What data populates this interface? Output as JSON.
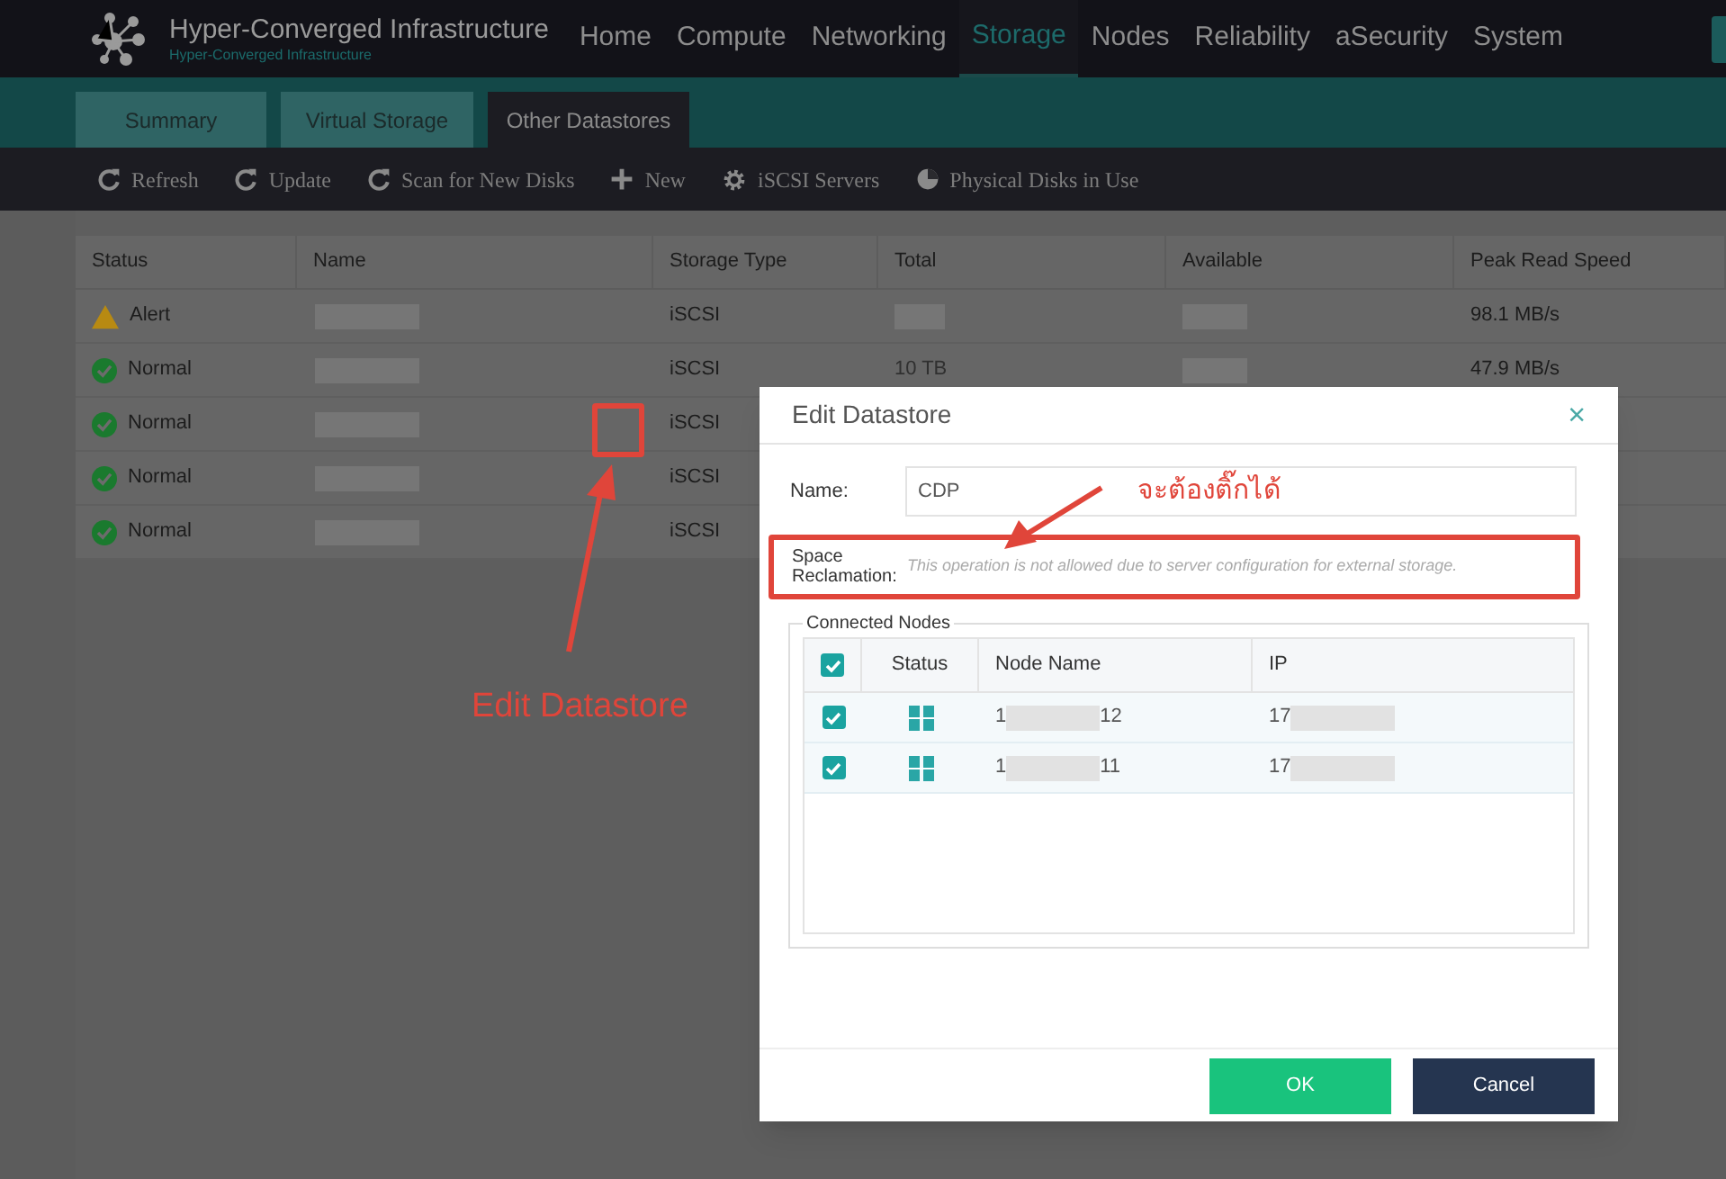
{
  "app": {
    "title": "Hyper-Converged Infrastructure",
    "subtitle": "Hyper-Converged Infrastructure"
  },
  "nav": [
    {
      "label": "Home",
      "selected": false
    },
    {
      "label": "Compute",
      "selected": false
    },
    {
      "label": "Networking",
      "selected": false
    },
    {
      "label": "Storage",
      "selected": true
    },
    {
      "label": "Nodes",
      "selected": false
    },
    {
      "label": "Reliability",
      "selected": false
    },
    {
      "label": "aSecurity",
      "selected": false
    },
    {
      "label": "System",
      "selected": false
    }
  ],
  "tabs": [
    {
      "label": "Summary",
      "selected": false
    },
    {
      "label": "Virtual Storage",
      "selected": false
    },
    {
      "label": "Other Datastores",
      "selected": true
    }
  ],
  "toolbar": [
    {
      "label": "Refresh",
      "kind": "refresh"
    },
    {
      "label": "Update",
      "kind": "refresh"
    },
    {
      "label": "Scan for New Disks",
      "kind": "refresh"
    },
    {
      "label": "New",
      "kind": "plus"
    },
    {
      "label": "iSCSI Servers",
      "kind": "gear"
    },
    {
      "label": "Physical Disks in Use",
      "kind": "pie"
    }
  ],
  "table": {
    "columns": [
      "Status",
      "Name",
      "Storage Type",
      "Total",
      "Available",
      "Peak Read Speed"
    ],
    "rows": [
      {
        "status": "Alert",
        "kind": "alert",
        "storage_type": "iSCSI",
        "total": "",
        "peak_read_speed": "98.1 MB/s"
      },
      {
        "status": "Normal",
        "kind": "normal",
        "storage_type": "iSCSI",
        "total": "10 TB",
        "peak_read_speed": "47.9 MB/s"
      },
      {
        "status": "Normal",
        "kind": "normal",
        "storage_type": "iSCSI"
      },
      {
        "status": "Normal",
        "kind": "normal",
        "storage_type": "iSCSI"
      },
      {
        "status": "Normal",
        "kind": "normal",
        "storage_type": "iSCSI"
      }
    ]
  },
  "dialog": {
    "title": "Edit Datastore",
    "close": "×",
    "name_label": "Name:",
    "name_value": "CDP",
    "reclamation_label": "Space Reclamation:",
    "reclamation_note": "This operation is not allowed due to server configuration for external storage.",
    "nodes_legend": "Connected Nodes",
    "nodes_columns": [
      "Status",
      "Node Name",
      "IP"
    ],
    "all_checked": true,
    "nodes": [
      {
        "checked": true,
        "name_prefix": "1",
        "name_suffix": "12",
        "ip_prefix": "17"
      },
      {
        "checked": true,
        "name_prefix": "1",
        "name_suffix": "11",
        "ip_prefix": "17"
      }
    ],
    "buttons": [
      {
        "label": "OK",
        "kind": "primary"
      },
      {
        "label": "Cancel",
        "kind": "secondary"
      }
    ]
  },
  "annotations": {
    "caption": "Edit Datastore",
    "note": "จะต้องติ๊กได้"
  }
}
